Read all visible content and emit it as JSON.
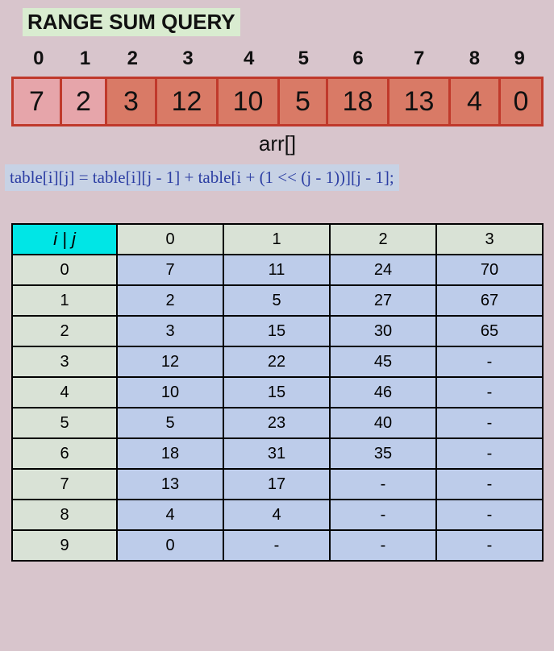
{
  "title": "RANGE SUM QUERY",
  "arr_label": "arr[]",
  "formula": "table[i][j] = table[i][j - 1] + table[i + (1 << (j - 1))][j - 1];",
  "indices": [
    "0",
    "1",
    "2",
    "3",
    "4",
    "5",
    "6",
    "7",
    "8",
    "9"
  ],
  "arr": [
    {
      "v": "7",
      "w": 60,
      "c": "light"
    },
    {
      "v": "2",
      "w": 56,
      "c": "light"
    },
    {
      "v": "3",
      "w": 62,
      "c": "dark"
    },
    {
      "v": "12",
      "w": 76,
      "c": "dark"
    },
    {
      "v": "10",
      "w": 76,
      "c": "dark"
    },
    {
      "v": "5",
      "w": 60,
      "c": "dark"
    },
    {
      "v": "18",
      "w": 76,
      "c": "dark"
    },
    {
      "v": "13",
      "w": 76,
      "c": "dark"
    },
    {
      "v": "4",
      "w": 62,
      "c": "dark"
    },
    {
      "v": "0",
      "w": 50,
      "c": "dark"
    }
  ],
  "table": {
    "corner": "i  |  j",
    "j_headers": [
      "0",
      "1",
      "2",
      "3"
    ],
    "i_headers": [
      "0",
      "1",
      "2",
      "3",
      "4",
      "5",
      "6",
      "7",
      "8",
      "9"
    ],
    "rows": [
      [
        "7",
        "11",
        "24",
        "70"
      ],
      [
        "2",
        "5",
        "27",
        "67"
      ],
      [
        "3",
        "15",
        "30",
        "65"
      ],
      [
        "12",
        "22",
        "45",
        "-"
      ],
      [
        "10",
        "15",
        "46",
        "-"
      ],
      [
        "5",
        "23",
        "40",
        "-"
      ],
      [
        "18",
        "31",
        "35",
        "-"
      ],
      [
        "13",
        "17",
        "-",
        "-"
      ],
      [
        "4",
        "4",
        "-",
        "-"
      ],
      [
        "0",
        "-",
        "-",
        "-"
      ]
    ]
  },
  "chart_data": {
    "type": "table",
    "title": "Sparse Table for Range Sum Query",
    "array": [
      7,
      2,
      3,
      12,
      10,
      5,
      18,
      13,
      4,
      0
    ],
    "columns": [
      "j=0",
      "j=1",
      "j=2",
      "j=3"
    ],
    "rows_index": [
      0,
      1,
      2,
      3,
      4,
      5,
      6,
      7,
      8,
      9
    ],
    "data": [
      [
        7,
        11,
        24,
        70
      ],
      [
        2,
        5,
        27,
        67
      ],
      [
        3,
        15,
        30,
        65
      ],
      [
        12,
        22,
        45,
        null
      ],
      [
        10,
        15,
        46,
        null
      ],
      [
        5,
        23,
        40,
        null
      ],
      [
        18,
        31,
        35,
        null
      ],
      [
        13,
        17,
        null,
        null
      ],
      [
        4,
        4,
        null,
        null
      ],
      [
        0,
        null,
        null,
        null
      ]
    ]
  }
}
